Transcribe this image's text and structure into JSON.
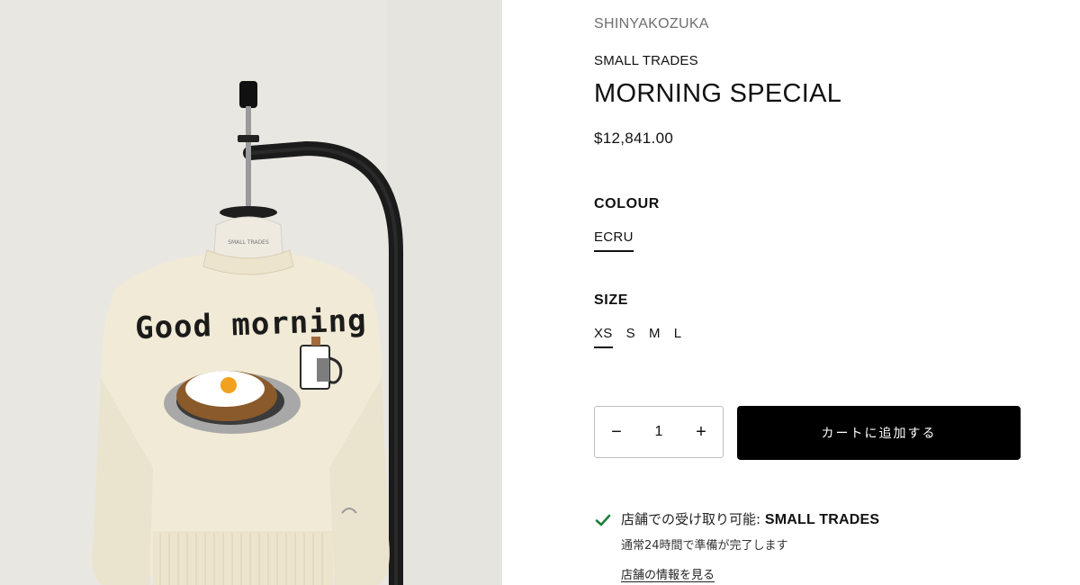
{
  "product": {
    "vendor": "SHINYAKOZUKA",
    "collection": "SMALL TRADES",
    "title": "MORNING SPECIAL",
    "price": "$12,841.00",
    "image_text": {
      "sweater_text": "Good morning",
      "neck_label": "SMALL TRADES"
    }
  },
  "options": {
    "colour_label": "COLOUR",
    "colour_value": "ECRU",
    "size_label": "SIZE",
    "sizes": [
      "XS",
      "S",
      "M",
      "L"
    ],
    "selected_size": "XS"
  },
  "quantity": {
    "minus": "−",
    "value": "1",
    "plus": "+"
  },
  "cart": {
    "add_label": "カートに追加する"
  },
  "pickup": {
    "status_prefix": "店舗での受け取り可能: ",
    "store": "SMALL TRADES",
    "ready_note": "通常24時間で準備が完了します",
    "store_link": "店舗の情報を見る"
  },
  "colors": {
    "button_bg": "#000000",
    "check_green": "#1e7f3c",
    "sweater": "#f1ead6",
    "background": "#e8e6e0"
  }
}
